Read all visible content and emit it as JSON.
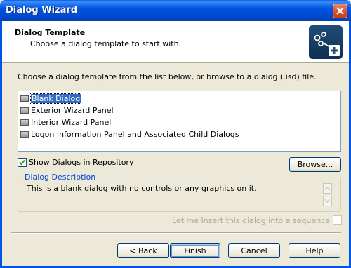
{
  "window": {
    "title": "Dialog Wizard"
  },
  "header": {
    "title": "Dialog Template",
    "subtitle": "Choose a dialog template to start with.",
    "icon": "dialog-wizard-icon"
  },
  "instruction": "Choose a dialog template from the list below, or browse to a dialog (.isd) file.",
  "templates": [
    {
      "label": "Blank Dialog",
      "selected": true
    },
    {
      "label": "Exterior Wizard Panel",
      "selected": false
    },
    {
      "label": "Interior Wizard Panel",
      "selected": false
    },
    {
      "label": "Logon Information Panel and Associated Child Dialogs",
      "selected": false
    }
  ],
  "show_repository": {
    "label": "Show Dialogs in Repository",
    "checked": true
  },
  "browse_button": "Browse...",
  "description": {
    "legend": "Dialog Description",
    "text": "This is a blank dialog with no controls or any graphics on it."
  },
  "insert_option": {
    "label": "Let me Insert this dialog into a sequence",
    "checked": false,
    "enabled": false
  },
  "buttons": {
    "back": "< Back",
    "finish": "Finish",
    "cancel": "Cancel",
    "help": "Help"
  },
  "colors": {
    "accent": "#0054e3",
    "selection": "#316ac5",
    "legend": "#0046d5"
  }
}
